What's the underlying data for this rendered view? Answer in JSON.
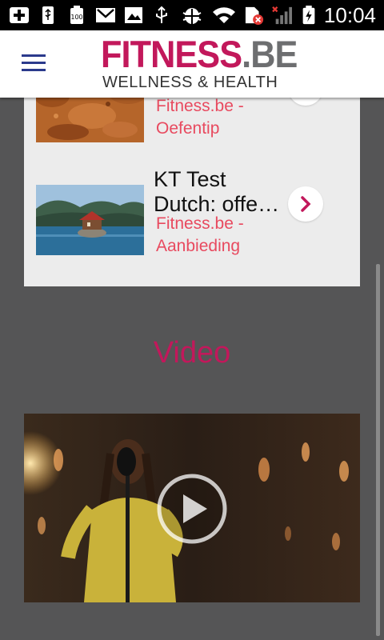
{
  "status_bar": {
    "time": "10:04",
    "icons": [
      "add-icon",
      "usb-icon",
      "battery-100-icon",
      "gmail-icon",
      "image-icon",
      "usb-icon",
      "android-debug-icon",
      "wifi-icon",
      "sim-error-icon",
      "signal-icon",
      "battery-charging-icon"
    ],
    "battery_badge": "100"
  },
  "header": {
    "logo_brand": "FITNESS",
    "logo_tld": ".BE",
    "logo_tagline": "WELLNESS & HEALTH",
    "colors": {
      "brand": "#c2185b",
      "tld": "#6d6e70",
      "menu": "#2b3a8c"
    }
  },
  "articles": [
    {
      "title": "",
      "category_line1": "Fitness.be -",
      "category_line2": "Oefentip"
    },
    {
      "title": "KT Test Dutch: offe…",
      "category_line1": "Fitness.be -",
      "category_line2": "Aanbieding"
    }
  ],
  "video_section": {
    "title": "Video"
  },
  "colors": {
    "background": "#555556",
    "panel": "#ececec",
    "accent": "#c2185b",
    "category": "#e84a5f"
  }
}
